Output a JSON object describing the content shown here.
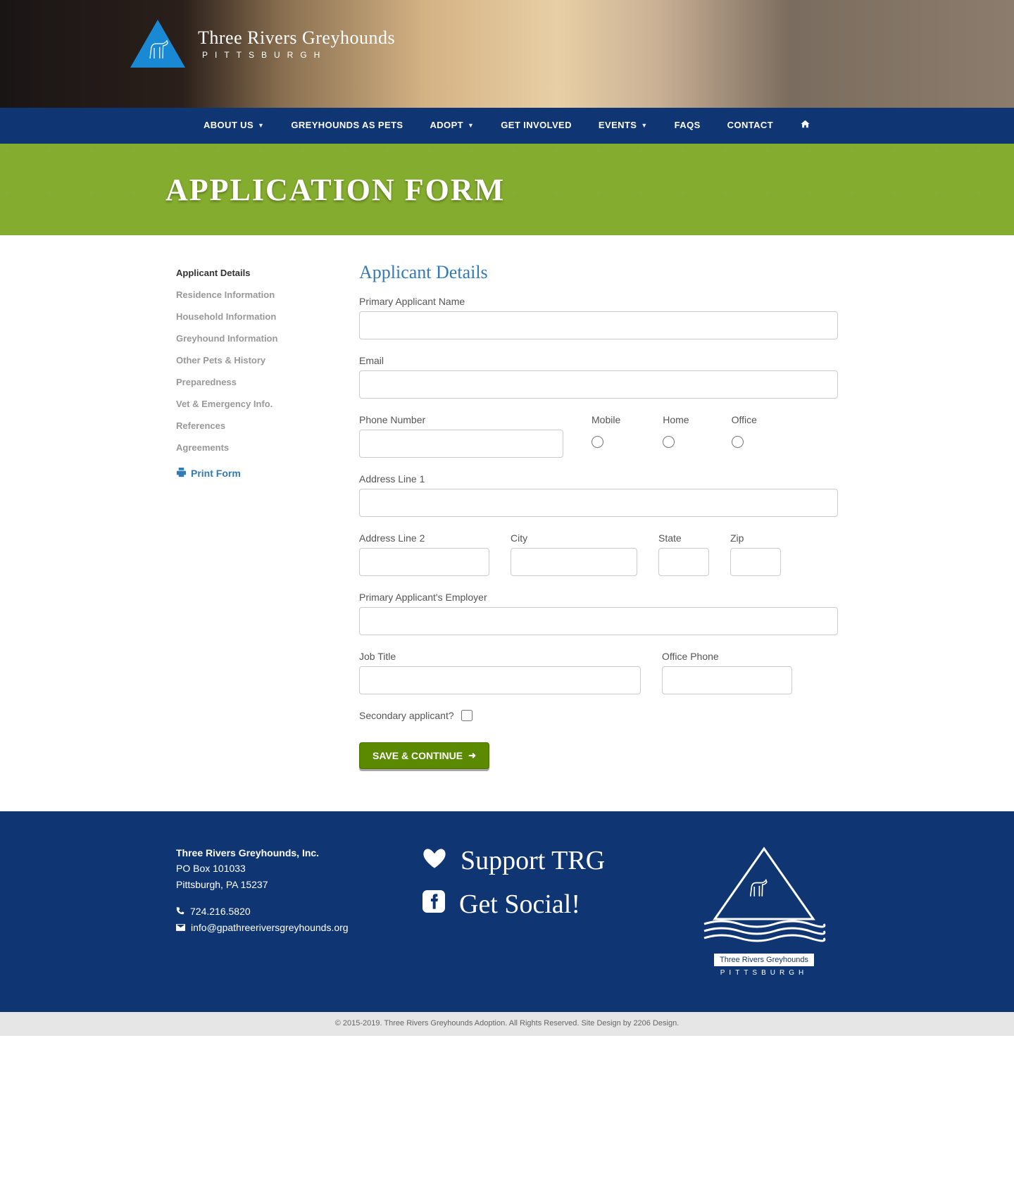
{
  "header": {
    "org_name": "Three Rivers Greyhounds",
    "org_city": "PITTSBURGH"
  },
  "nav": {
    "about": "ABOUT US",
    "pets": "GREYHOUNDS AS PETS",
    "adopt": "ADOPT",
    "involved": "GET INVOLVED",
    "events": "EVENTS",
    "faqs": "FAQS",
    "contact": "CONTACT"
  },
  "banner": {
    "title": "APPLICATION FORM"
  },
  "sidebar": {
    "steps": [
      "Applicant Details",
      "Residence Information",
      "Household Information",
      "Greyhound Information",
      "Other Pets & History",
      "Preparedness",
      "Vet & Emergency Info.",
      "References",
      "Agreements"
    ],
    "print": "Print Form"
  },
  "form": {
    "section_title": "Applicant Details",
    "primary_name": "Primary Applicant Name",
    "email": "Email",
    "phone": "Phone Number",
    "phone_mobile": "Mobile",
    "phone_home": "Home",
    "phone_office": "Office",
    "addr1": "Address Line 1",
    "addr2": "Address Line 2",
    "city": "City",
    "state": "State",
    "zip": "Zip",
    "employer": "Primary Applicant's Employer",
    "job_title": "Job Title",
    "office_phone": "Office Phone",
    "secondary": "Secondary applicant?",
    "save": "SAVE & CONTINUE"
  },
  "footer": {
    "org": "Three Rivers Greyhounds, Inc.",
    "po": "PO Box 101033",
    "citystate": "Pittsburgh, PA 15237",
    "phone": "724.216.5820",
    "email": "info@gpathreeriversgreyhounds.org",
    "support": "Support TRG",
    "social": "Get Social!",
    "logo_name": "Three Rivers Greyhounds",
    "logo_city": "PITTSBURGH"
  },
  "copyright": {
    "text": "© 2015-2019. Three Rivers Greyhounds Adoption. All Rights Reserved. Site Design by ",
    "link": "2206 Design."
  }
}
